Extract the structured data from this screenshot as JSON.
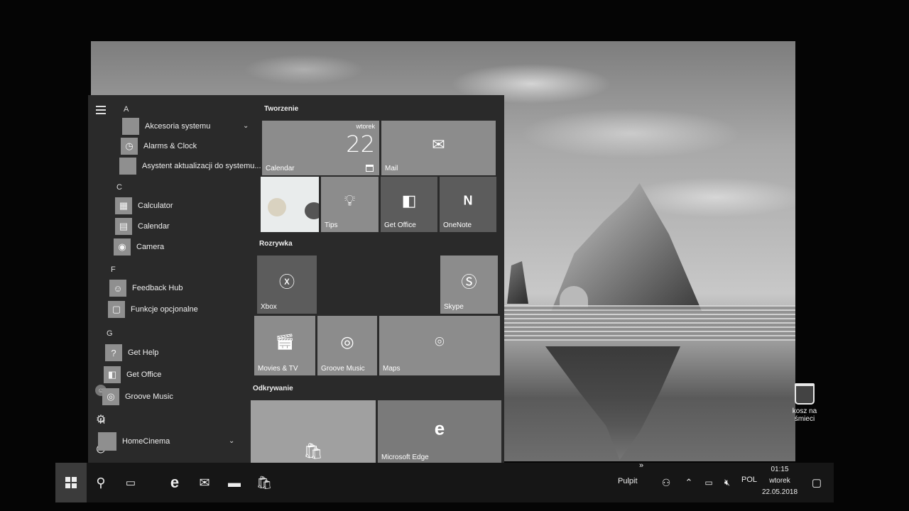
{
  "desktop": {
    "recycle_bin_label_line1": "kosz na",
    "recycle_bin_label_line2": "śmieci"
  },
  "start_menu": {
    "app_list": [
      {
        "type": "letter",
        "text": "A"
      },
      {
        "type": "app",
        "label": "Akcesoria systemu",
        "icon": "folder-icon",
        "expandable": true
      },
      {
        "type": "app",
        "label": "Alarms & Clock",
        "icon": "clock-icon"
      },
      {
        "type": "app",
        "label": "Asystent aktualizacji do systemu...",
        "icon": "update-icon"
      },
      {
        "type": "letter",
        "text": "C"
      },
      {
        "type": "app",
        "label": "Calculator",
        "icon": "calculator-icon"
      },
      {
        "type": "app",
        "label": "Calendar",
        "icon": "calendar-icon"
      },
      {
        "type": "app",
        "label": "Camera",
        "icon": "camera-icon"
      },
      {
        "type": "letter",
        "text": "F"
      },
      {
        "type": "app",
        "label": "Feedback Hub",
        "icon": "feedback-icon"
      },
      {
        "type": "app",
        "label": "Funkcje opcjonalne",
        "icon": "optional-features-icon"
      },
      {
        "type": "letter",
        "text": "G"
      },
      {
        "type": "app",
        "label": "Get Help",
        "icon": "help-icon"
      },
      {
        "type": "app",
        "label": "Get Office",
        "icon": "office-icon"
      },
      {
        "type": "app",
        "label": "Groove Music",
        "icon": "music-icon"
      },
      {
        "type": "letter",
        "text": "H"
      },
      {
        "type": "app",
        "label": "HomeCinema",
        "icon": "folder-icon",
        "expandable": true
      }
    ],
    "groups": {
      "tworzenie": "Tworzenie",
      "rozrywka": "Rozrywka",
      "odkrywanie": "Odkrywanie"
    },
    "tiles": {
      "calendar": {
        "label": "Calendar",
        "day_name": "wtorek",
        "day_number": "22"
      },
      "mail": {
        "label": "Mail"
      },
      "tips": {
        "label": "Tips"
      },
      "get_office": {
        "label": "Get Office"
      },
      "onenote": {
        "label": "OneNote"
      },
      "xbox": {
        "label": "Xbox"
      },
      "skype": {
        "label": "Skype"
      },
      "movies": {
        "label": "Movies & TV"
      },
      "groove": {
        "label": "Groove Music"
      },
      "maps": {
        "label": "Maps"
      },
      "store": {
        "label": ""
      },
      "edge": {
        "label": "Microsoft Edge"
      }
    }
  },
  "taskbar": {
    "desktop_toolbar_label": "Pulpit",
    "language": "POL",
    "clock_time": "01:15",
    "clock_day": "wtorek",
    "clock_date": "22.05.2018",
    "toolbar_overflow": "»"
  }
}
